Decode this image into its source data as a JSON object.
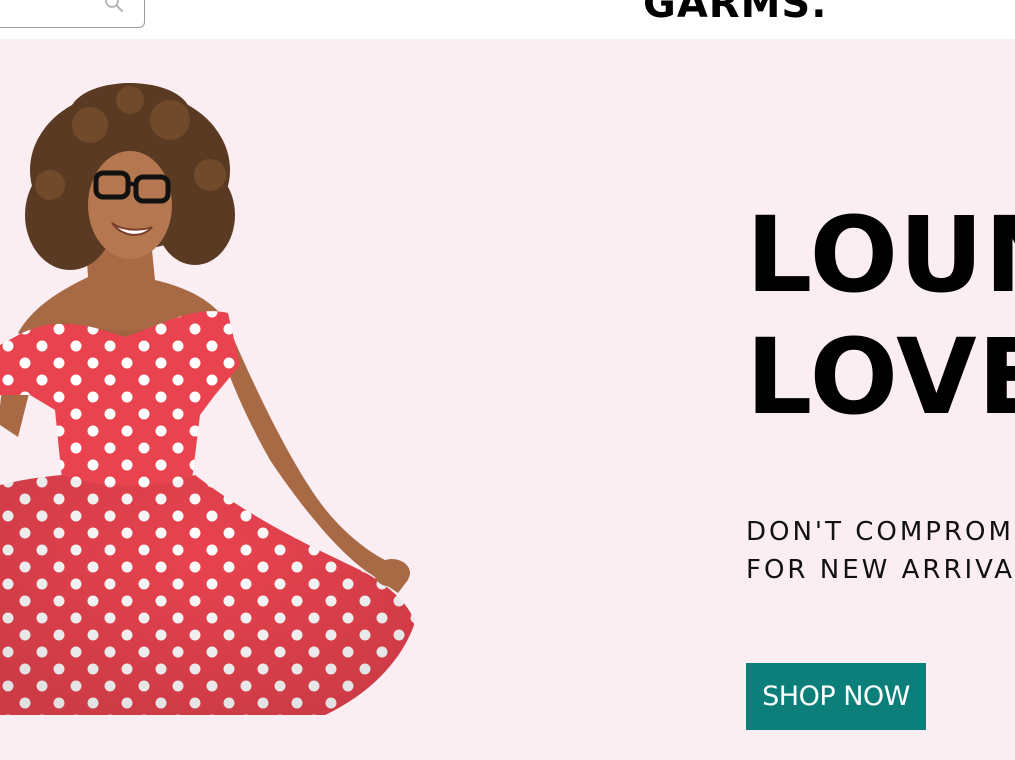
{
  "header": {
    "search": {
      "placeholder": ""
    },
    "logo_text": "GARMS.",
    "icons": {
      "search": "search-icon"
    }
  },
  "hero": {
    "headline_lines": [
      "LOUN",
      "LOVE"
    ],
    "subtext_lines": [
      "DON'T COMPROM",
      "FOR NEW ARRIVA"
    ],
    "cta_label": "SHOP NOW",
    "colors": {
      "background": "#fbeef2",
      "cta_background": "#0d7f7a",
      "cta_text": "#ffffff",
      "dress": "#e8434f",
      "dots": "#ffffff"
    }
  }
}
